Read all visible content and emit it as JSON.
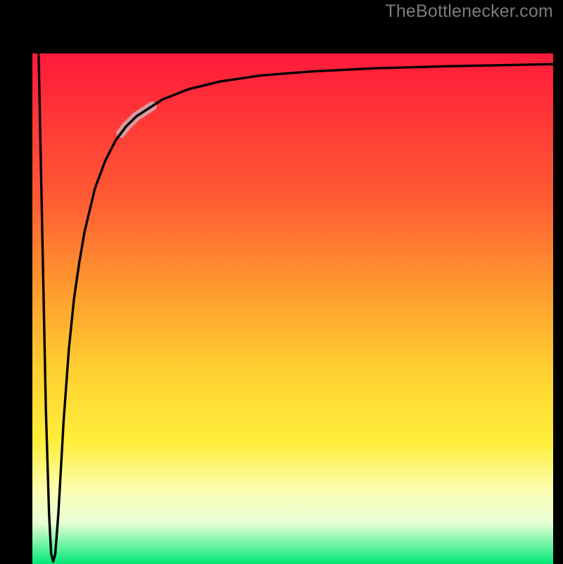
{
  "watermark": "TheBottlenecker.com",
  "chart_data": {
    "type": "line",
    "title": "",
    "xlabel": "",
    "ylabel": "",
    "xlim": [
      0,
      100
    ],
    "ylim": [
      0,
      100
    ],
    "grid": false,
    "legend": false,
    "background_gradient": {
      "top": "#ff1a3a",
      "mid_top": "#ff7a2a",
      "mid": "#ffe63a",
      "mid_low": "#faffc8",
      "bottom": "#00e874"
    },
    "series": [
      {
        "name": "curve",
        "x": [
          1.2,
          2.0,
          2.6,
          3.2,
          3.6,
          4.0,
          4.4,
          5.0,
          6.0,
          7.0,
          8.0,
          9.0,
          10.0,
          12.0,
          14.0,
          16.0,
          18.0,
          20.0,
          25.0,
          30.0,
          36.0,
          44.0,
          54.0,
          66.0,
          80.0,
          100.0
        ],
        "y": [
          100.0,
          60.0,
          30.0,
          10.0,
          2.0,
          0.5,
          2.0,
          10.0,
          28.0,
          42.0,
          52.0,
          59.0,
          65.0,
          73.5,
          79.0,
          83.0,
          85.7,
          87.7,
          91.0,
          93.0,
          94.5,
          95.7,
          96.5,
          97.1,
          97.5,
          97.9
        ]
      }
    ],
    "highlight_segment": {
      "series": "curve",
      "x_range": [
        17.0,
        23.0
      ],
      "note": "short thick pale-pink segment overlay on the rising limb"
    }
  }
}
